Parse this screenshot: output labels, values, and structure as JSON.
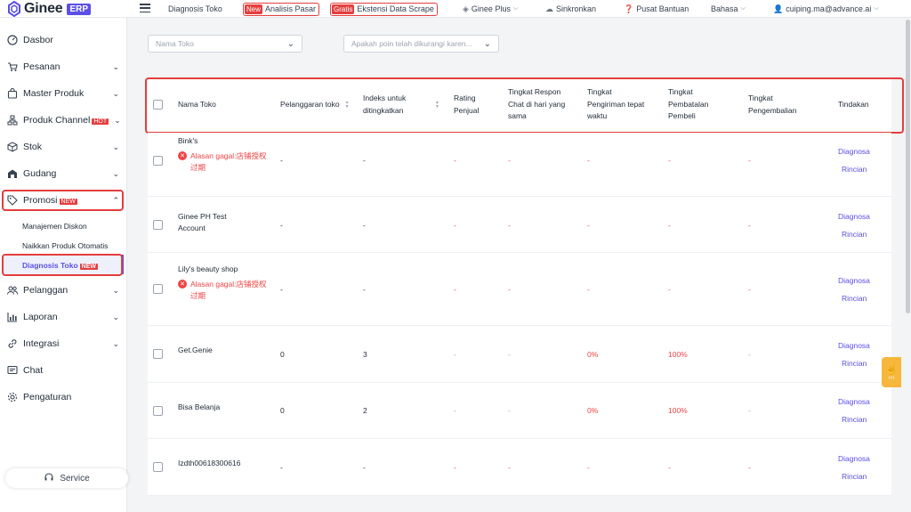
{
  "brand": {
    "name": "Ginee",
    "badge": "ERP"
  },
  "topbar": {
    "page": "Diagnosis Toko",
    "analisis_tag": "New",
    "analisis_label": "Analisis Pasar",
    "ekstensi_tag": "Gratis",
    "ekstensi_label": "Ekstensi Data Scrape",
    "plus": "Ginee Plus",
    "sync": "Sinkronkan",
    "help": "Pusat Bantuan",
    "language": "Bahasa",
    "user": "cuiping.ma@advance.ai"
  },
  "sidebar": {
    "items": [
      {
        "label": "Dasbor",
        "icon": "dashboard-icon"
      },
      {
        "label": "Pesanan",
        "icon": "cart-icon"
      },
      {
        "label": "Master Produk",
        "icon": "bag-icon"
      },
      {
        "label": "Produk Channel",
        "icon": "channel-icon",
        "badge": "HOT"
      },
      {
        "label": "Stok",
        "icon": "box-icon"
      },
      {
        "label": "Gudang",
        "icon": "warehouse-icon"
      },
      {
        "label": "Promosi",
        "icon": "tag-icon",
        "badge": "NEW"
      },
      {
        "label": "Pelanggan",
        "icon": "users-icon"
      },
      {
        "label": "Laporan",
        "icon": "chart-icon"
      },
      {
        "label": "Integrasi",
        "icon": "link-icon"
      },
      {
        "label": "Chat",
        "icon": "chat-icon"
      },
      {
        "label": "Pengaturan",
        "icon": "settings-icon"
      }
    ],
    "sub_items": [
      {
        "label": "Manajemen Diskon"
      },
      {
        "label": "Naikkan Produk Otomatis"
      },
      {
        "label": "Diagnosis Toko",
        "badge": "NEW"
      }
    ],
    "service": "Service"
  },
  "filters": {
    "store_placeholder": "Nama Toko",
    "reason_placeholder": "Apakah poin telah dikurangi karen..."
  },
  "table": {
    "headers": [
      "Nama Toko",
      "Pelanggaran toko",
      "Indeks untuk ditingkatkan",
      "Rating Penjual",
      "Tingkat Respon Chat di hari yang sama",
      "Tingkat Pengiriman tepat waktu",
      "Tingkat Pembatalan Pembeli",
      "Tingkat Pengembalian",
      "Tindakan"
    ],
    "action_diagnose": "Diagnosa",
    "action_detail": "Rincian",
    "rows": [
      {
        "name": "Bink's",
        "fail": "Alasan gagal:店铺授权过期",
        "violation": "-",
        "index": "-",
        "rating": "-",
        "chat": "-",
        "shipping": "-",
        "cancel": "-",
        "return": "-"
      },
      {
        "name": "Ginee PH Test Account",
        "fail": "",
        "violation": "-",
        "index": "-",
        "rating": "-",
        "chat": "-",
        "shipping": "-",
        "cancel": "-",
        "return": "-"
      },
      {
        "name": "Lily's beauty shop",
        "fail": "Alasan gagal:店铺授权过期",
        "violation": "-",
        "index": "-",
        "rating": "-",
        "chat": "-",
        "shipping": "-",
        "cancel": "-",
        "return": "-"
      },
      {
        "name": "Get.Genie",
        "fail": "",
        "violation": "0",
        "index": "3",
        "rating": "-",
        "chat": "-",
        "shipping": "0%",
        "cancel": "100%",
        "return": "-"
      },
      {
        "name": "Bisa Belanja",
        "fail": "",
        "violation": "0",
        "index": "2",
        "rating": "-",
        "chat": "-",
        "shipping": "0%",
        "cancel": "100%",
        "return": "-"
      },
      {
        "name": "Izdth00618300616",
        "fail": "",
        "violation": "-",
        "index": "-",
        "rating": "-",
        "chat": "-",
        "shipping": "-",
        "cancel": "-",
        "return": "-"
      }
    ]
  },
  "colors": {
    "accent": "#5b4fe6",
    "danger": "#e53e3e",
    "widget": "#f6b73c"
  }
}
